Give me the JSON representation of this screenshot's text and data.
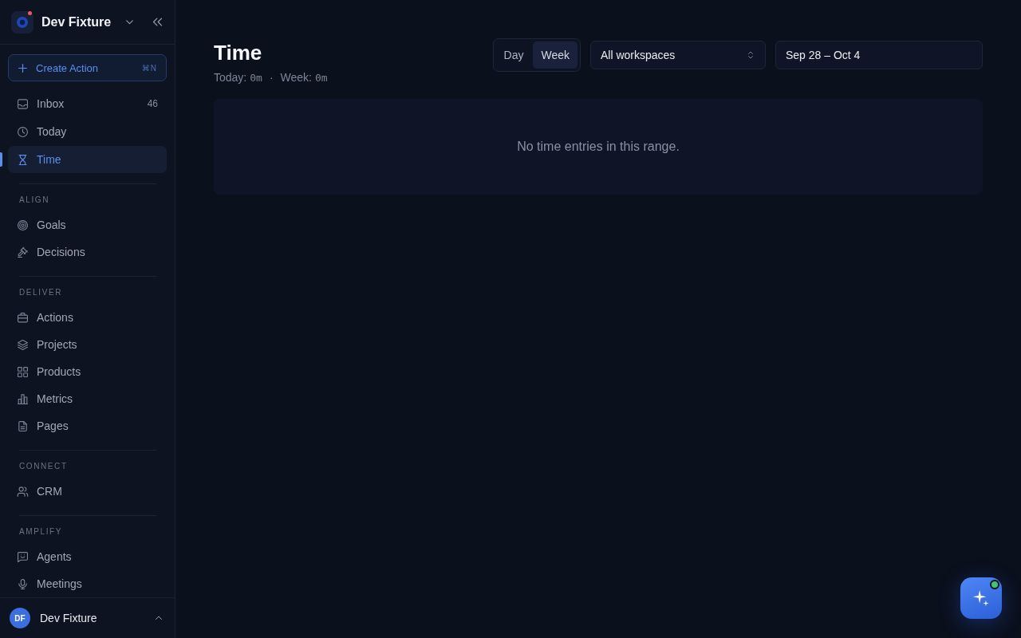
{
  "workspace": {
    "name": "Dev Fixture",
    "unread": true
  },
  "create_button": {
    "label": "Create Action",
    "shortcut": "⌘N"
  },
  "nav": [
    {
      "label": "Inbox",
      "count": "46",
      "selected": false
    },
    {
      "label": "Today",
      "selected": false
    },
    {
      "label": "Time",
      "selected": true
    }
  ],
  "sections": [
    {
      "title": "ALIGN",
      "items": [
        {
          "label": "Goals",
          "selected": false
        },
        {
          "label": "Decisions",
          "selected": false
        }
      ]
    },
    {
      "title": "DELIVER",
      "items": [
        {
          "label": "Actions",
          "selected": false
        },
        {
          "label": "Projects",
          "selected": false
        },
        {
          "label": "Products",
          "selected": false
        },
        {
          "label": "Metrics",
          "selected": false
        },
        {
          "label": "Pages",
          "selected": false
        }
      ]
    },
    {
      "title": "CONNECT",
      "items": [
        {
          "label": "CRM",
          "selected": false
        }
      ]
    },
    {
      "title": "AMPLIFY",
      "items": [
        {
          "label": "Agents",
          "selected": false
        },
        {
          "label": "Meetings",
          "selected": false
        }
      ]
    }
  ],
  "user": {
    "initials": "DF",
    "name": "Dev Fixture"
  },
  "page": {
    "title": "Time",
    "stats": [
      {
        "label": "Today:",
        "value": "0m"
      },
      {
        "label": "Week:",
        "value": "0m"
      }
    ],
    "separator": "·"
  },
  "range_toggle": [
    {
      "label": "Day",
      "selected": false
    },
    {
      "label": "Week",
      "selected": true
    }
  ],
  "workspace_select": {
    "value": "All workspaces"
  },
  "date_range": {
    "value": "Sep 28 – Oct 4"
  },
  "empty_state": {
    "message": "No time entries in this range."
  },
  "assistant": {
    "online": true
  }
}
